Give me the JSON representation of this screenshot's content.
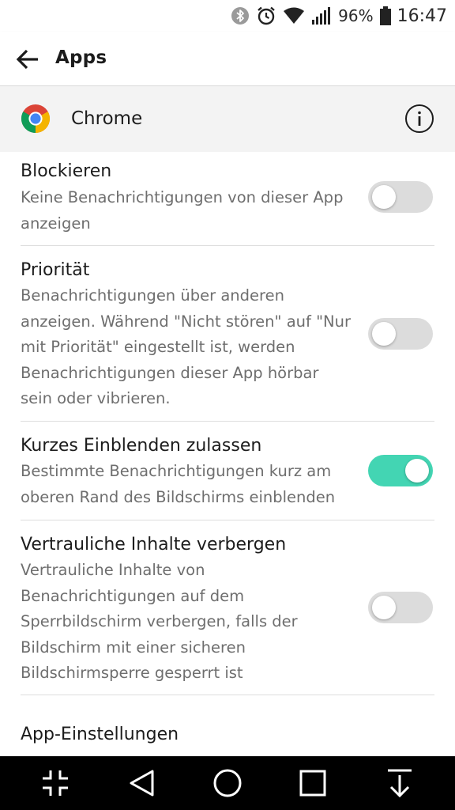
{
  "status_bar": {
    "icons": [
      "bluetooth-icon",
      "alarm-icon",
      "wifi-icon",
      "signal-icon",
      "battery-icon"
    ],
    "battery": "96%",
    "time": "16:47"
  },
  "app_bar": {
    "back_icon": "arrow-left-icon",
    "title": "Apps"
  },
  "app_header": {
    "app_icon": "chrome-logo",
    "app_name": "Chrome",
    "info_icon": "info-icon"
  },
  "settings": [
    {
      "title": "Blockieren",
      "description": "Keine Benachrichtigungen von dieser App anzeigen",
      "enabled": false
    },
    {
      "title": "Priorität",
      "description": "Benachrichtigungen über anderen anzeigen. Während \"Nicht stören\" auf \"Nur mit Priorität\" eingestellt ist, werden Benachrichtigungen dieser App hörbar sein oder vibrieren.",
      "enabled": false
    },
    {
      "title": "Kurzes Einblenden zulassen",
      "description": "Bestimmte Benachrichtigungen kurz am oberen Rand des Bildschirms einblenden",
      "enabled": true
    },
    {
      "title": "Vertrauliche Inhalte verbergen",
      "description": "Vertrauliche Inhalte von Benachrichtigungen auf dem Sperrbildschirm verbergen, falls der Bildschirm mit einer sicheren Bildschirmsperre gesperrt ist",
      "enabled": false
    }
  ],
  "section_label": "App-Einstellungen",
  "colors": {
    "toggle_on": "#43d5b3",
    "toggle_off": "#dcdcdc",
    "header_bg": "#f3f3f3",
    "nav_bg": "#000000"
  },
  "nav_bar": {
    "buttons": [
      "collapse-icon",
      "back-triangle-icon",
      "home-circle-icon",
      "recents-square-icon",
      "notification-pull-icon"
    ]
  }
}
